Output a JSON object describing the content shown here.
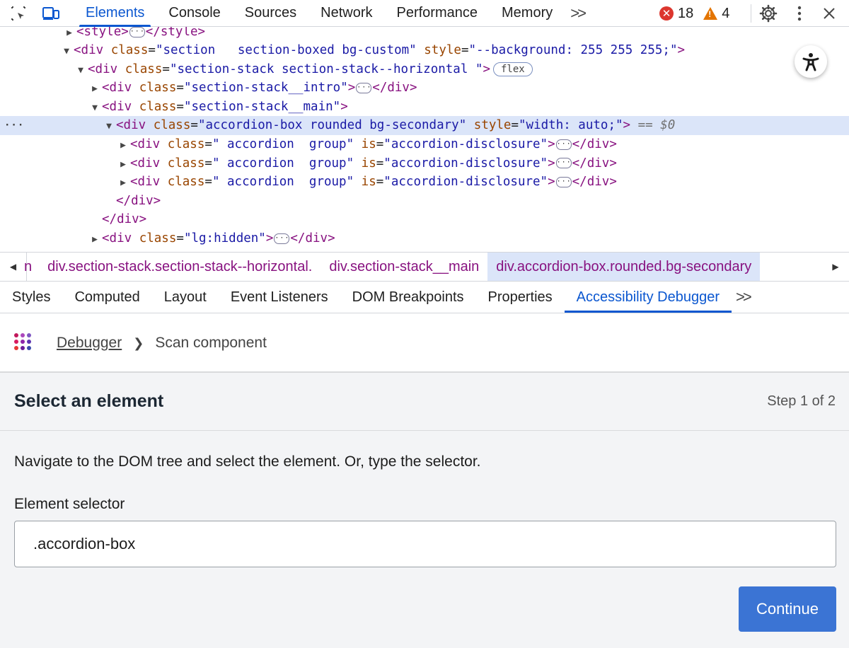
{
  "toolbar": {
    "tabs": [
      "Elements",
      "Console",
      "Sources",
      "Network",
      "Performance",
      "Memory"
    ],
    "more_tabs": ">>",
    "errors_count": "18",
    "warnings_count": "4",
    "icons": [
      "inspect-element-icon",
      "device-toolbar-icon",
      "gear-icon",
      "kebab-menu-icon",
      "close-icon"
    ]
  },
  "dom_tree": {
    "lines": {
      "l0": {
        "open": "<",
        "tag": "style",
        "close": ">",
        "end": "</style>"
      },
      "l1": {
        "tag": "div",
        "attr1_name": "class",
        "attr1_value": "\"section   section-boxed bg-custom\"",
        "attr2_name": "style",
        "attr2_value": "\"--background: 255 255 255;\""
      },
      "l2": {
        "tag": "div",
        "attr1_name": "class",
        "attr1_value": "\"section-stack section-stack--horizontal \"",
        "badge": "flex"
      },
      "l3": {
        "tag": "div",
        "attr1_name": "class",
        "attr1_value": "\"section-stack__intro\"",
        "end": "</div>"
      },
      "l4": {
        "tag": "div",
        "attr1_name": "class",
        "attr1_value": "\"section-stack__main\""
      },
      "l5": {
        "tag": "div",
        "attr1_name": "class",
        "attr1_value": "\"accordion-box rounded bg-secondary\"",
        "attr2_name": "style",
        "attr2_value": "\"width: auto;\"",
        "eq": "==",
        "ref": "$0"
      },
      "l6": {
        "tag": "div",
        "attr1_name": "class",
        "attr1_value": "\" accordion  group\"",
        "attr2_name": "is",
        "attr2_value": "\"accordion-disclosure\"",
        "end": "</div>"
      },
      "l7": {
        "tag": "div",
        "attr1_name": "class",
        "attr1_value": "\" accordion  group\"",
        "attr2_name": "is",
        "attr2_value": "\"accordion-disclosure\"",
        "end": "</div>"
      },
      "l8": {
        "tag": "div",
        "attr1_name": "class",
        "attr1_value": "\" accordion  group\"",
        "attr2_name": "is",
        "attr2_value": "\"accordion-disclosure\"",
        "end": "</div>"
      },
      "l9": {
        "end": "</div>"
      },
      "l10": {
        "end": "</div>"
      },
      "l11": {
        "tag": "div",
        "attr1_name": "class",
        "attr1_value": "\"lg:hidden\"",
        "end": "</div>"
      }
    },
    "ellipsis": "···",
    "row_dots": "···"
  },
  "breadcrumbs": {
    "cut": "n",
    "items": [
      "div.section-stack.section-stack--horizontal.",
      "div.section-stack__main",
      "div.accordion-box.rounded.bg-secondary"
    ]
  },
  "subtabs": [
    "Styles",
    "Computed",
    "Layout",
    "Event Listeners",
    "DOM Breakpoints",
    "Properties",
    "Accessibility Debugger"
  ],
  "subtabs_more": ">>",
  "debugger": {
    "breadcrumb_link": "Debugger",
    "breadcrumb_current": "Scan component",
    "step_title": "Select an element",
    "step_count": "Step 1 of 2",
    "instructions": "Navigate to the DOM tree and select the element. Or, type the selector.",
    "field_label": "Element selector",
    "selector_value": ".accordion-box",
    "continue_label": "Continue"
  },
  "colors": {
    "accent": "#0b57d0",
    "button": "#3b74d4",
    "error": "#dc362e",
    "warning": "#e37400",
    "selected_row": "#dbe5f9",
    "tag": "#881280",
    "attr_name": "#994500",
    "attr_value": "#1a1aa6"
  }
}
